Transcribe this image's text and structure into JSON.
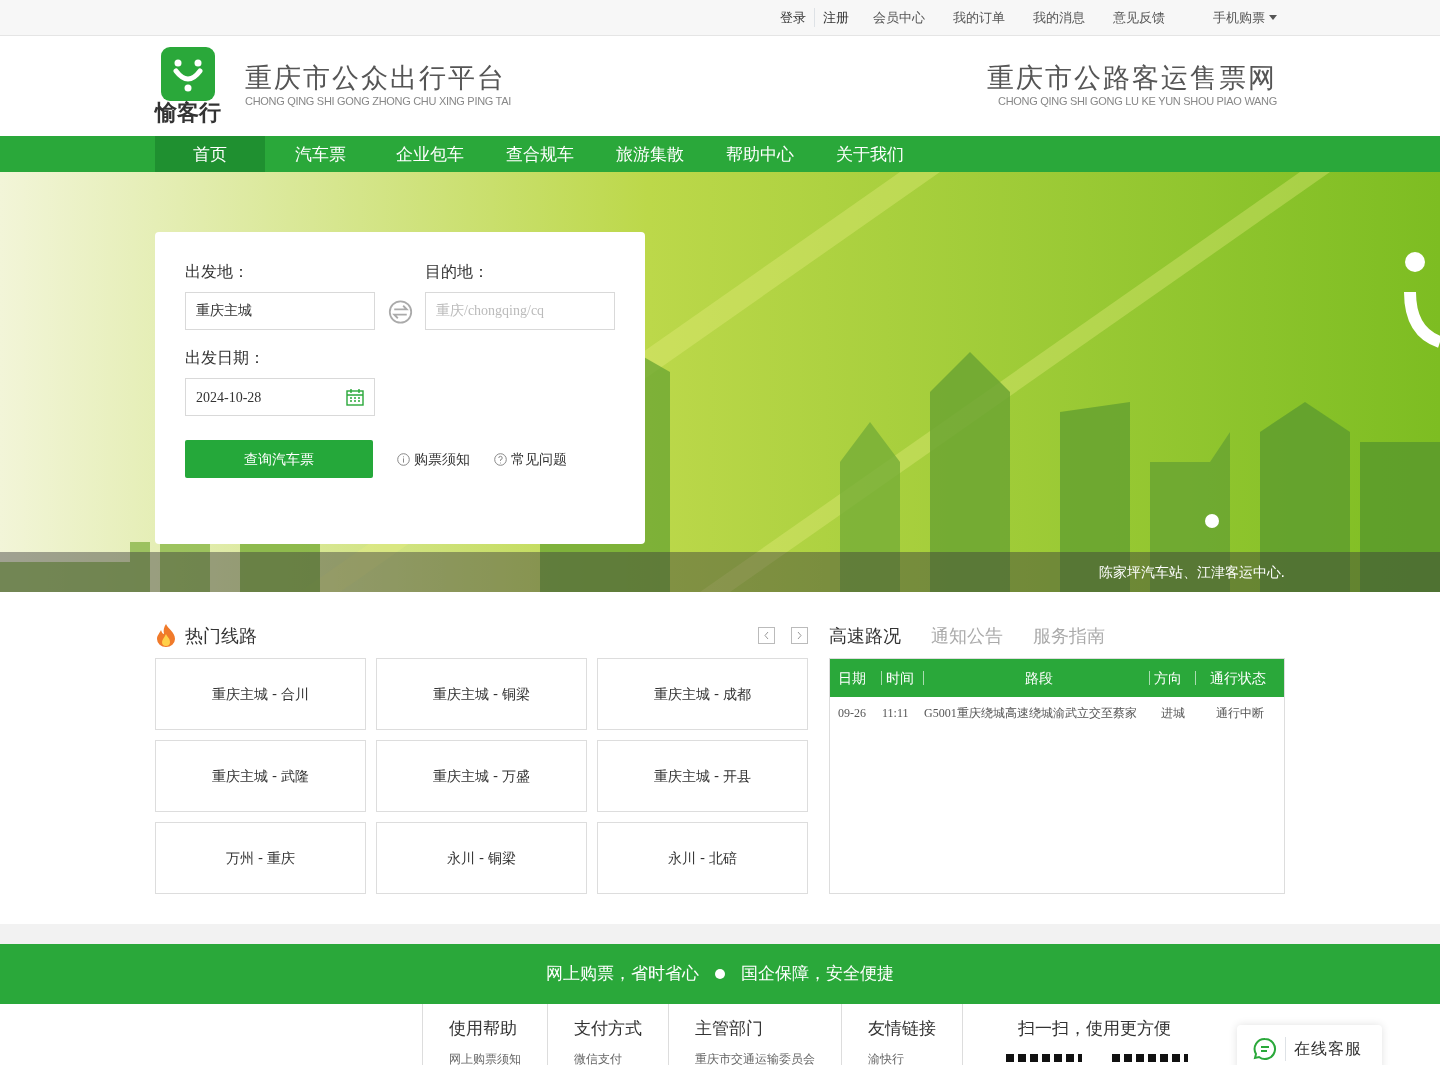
{
  "top_bar": {
    "auth_links": [
      "登录",
      "注册"
    ],
    "links": [
      "会员中心",
      "我的订单",
      "我的消息",
      "意见反馈"
    ],
    "dropdown": "手机购票"
  },
  "header": {
    "logo_text": "愉客行",
    "title": "重庆市公众出行平台",
    "title_pinyin": "CHONG QING SHI GONG ZHONG CHU XING PING TAI",
    "site_title": "重庆市公路客运售票网",
    "site_pinyin": "CHONG QING SHI GONG LU KE YUN SHOU PIAO WANG"
  },
  "nav": [
    {
      "label": "首页",
      "selected": true
    },
    {
      "label": "汽车票",
      "selected": false
    },
    {
      "label": "企业包车",
      "selected": false
    },
    {
      "label": "查合规车",
      "selected": false
    },
    {
      "label": "旅游集散",
      "selected": false
    },
    {
      "label": "帮助中心",
      "selected": false
    },
    {
      "label": "关于我们",
      "selected": false
    }
  ],
  "search": {
    "from_label": "出发地：",
    "from_value": "重庆主城",
    "to_label": "目的地：",
    "to_placeholder": "重庆/chongqing/cq",
    "date_label": "出发日期：",
    "date_value": "2024-10-28",
    "submit": "查询汽车票",
    "links": [
      "购票须知",
      "常见问题"
    ]
  },
  "banner": {
    "kind": "picture",
    "caption": "陈家坪汽车站、江津客运中心."
  },
  "hot_routes": {
    "title": "热门线路",
    "routes": [
      "重庆主城 - 合川",
      "重庆主城 - 铜梁",
      "重庆主城 - 成都",
      "重庆主城 - 武隆",
      "重庆主城 - 万盛",
      "重庆主城 - 开县",
      "万州 - 重庆",
      "永川 - 铜梁",
      "永川 - 北碚"
    ]
  },
  "info_tabs": [
    {
      "label": "高速路况",
      "selected": true
    },
    {
      "label": "通知公告",
      "selected": false
    },
    {
      "label": "服务指南",
      "selected": false
    }
  ],
  "road_table": {
    "columns": [
      "日期",
      "时间",
      "路段",
      "方向",
      "通行状态"
    ],
    "rows": [
      [
        "09-26",
        "11:11",
        "G5001重庆绕城高速绕城渝武立交至蔡家",
        "进城",
        "通行中断"
      ]
    ]
  },
  "slogan": [
    "网上购票，省时省心",
    "国企保障，安全便捷"
  ],
  "footer": {
    "columns": [
      {
        "title": "使用帮助",
        "links": [
          "网上购票须知"
        ]
      },
      {
        "title": "支付方式",
        "links": [
          "微信支付"
        ]
      },
      {
        "title": "主管部门",
        "links": [
          "重庆市交通运输委员会"
        ]
      },
      {
        "title": "友情链接",
        "links": [
          "渝快行"
        ]
      }
    ],
    "qr_title": "扫一扫，使用更方便"
  },
  "online_service": "在线客服"
}
